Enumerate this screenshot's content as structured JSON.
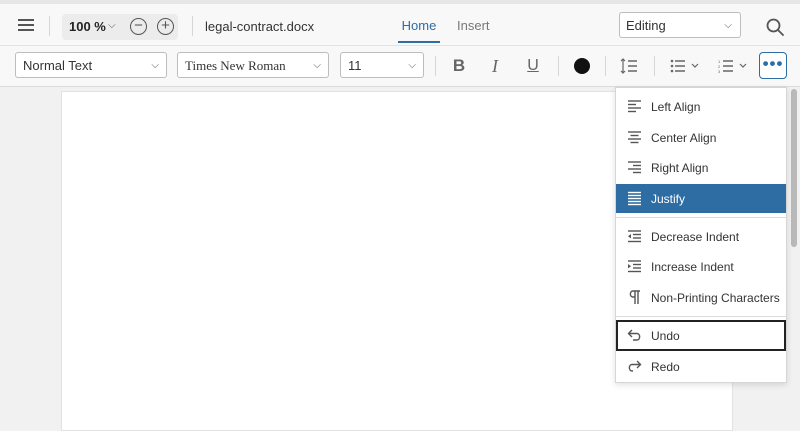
{
  "topbar": {
    "zoom": "100 %",
    "filename": "legal-contract.docx",
    "tabs": [
      {
        "label": "Home"
      },
      {
        "label": "Insert"
      }
    ],
    "mode": "Editing"
  },
  "toolbar": {
    "style": "Normal Text",
    "font": "Times New Roman",
    "size": "11",
    "bold_label": "B",
    "italic_label": "I",
    "underline_label": "U",
    "text_color": "#111111",
    "more_label": "•••"
  },
  "menu": {
    "items": [
      {
        "label": "Left Align",
        "icon": "align-left-icon"
      },
      {
        "label": "Center Align",
        "icon": "align-center-icon"
      },
      {
        "label": "Right Align",
        "icon": "align-right-icon"
      },
      {
        "label": "Justify",
        "icon": "align-justify-icon",
        "active": true
      },
      {
        "label": "Decrease Indent",
        "icon": "indent-decrease-icon"
      },
      {
        "label": "Increase Indent",
        "icon": "indent-increase-icon"
      },
      {
        "label": "Non-Printing Characters",
        "icon": "pilcrow-icon"
      },
      {
        "label": "Undo",
        "icon": "undo-icon"
      },
      {
        "label": "Redo",
        "icon": "redo-icon"
      }
    ]
  },
  "colors": {
    "accent": "#2d6da3",
    "active_bg": "#2d6da3"
  }
}
